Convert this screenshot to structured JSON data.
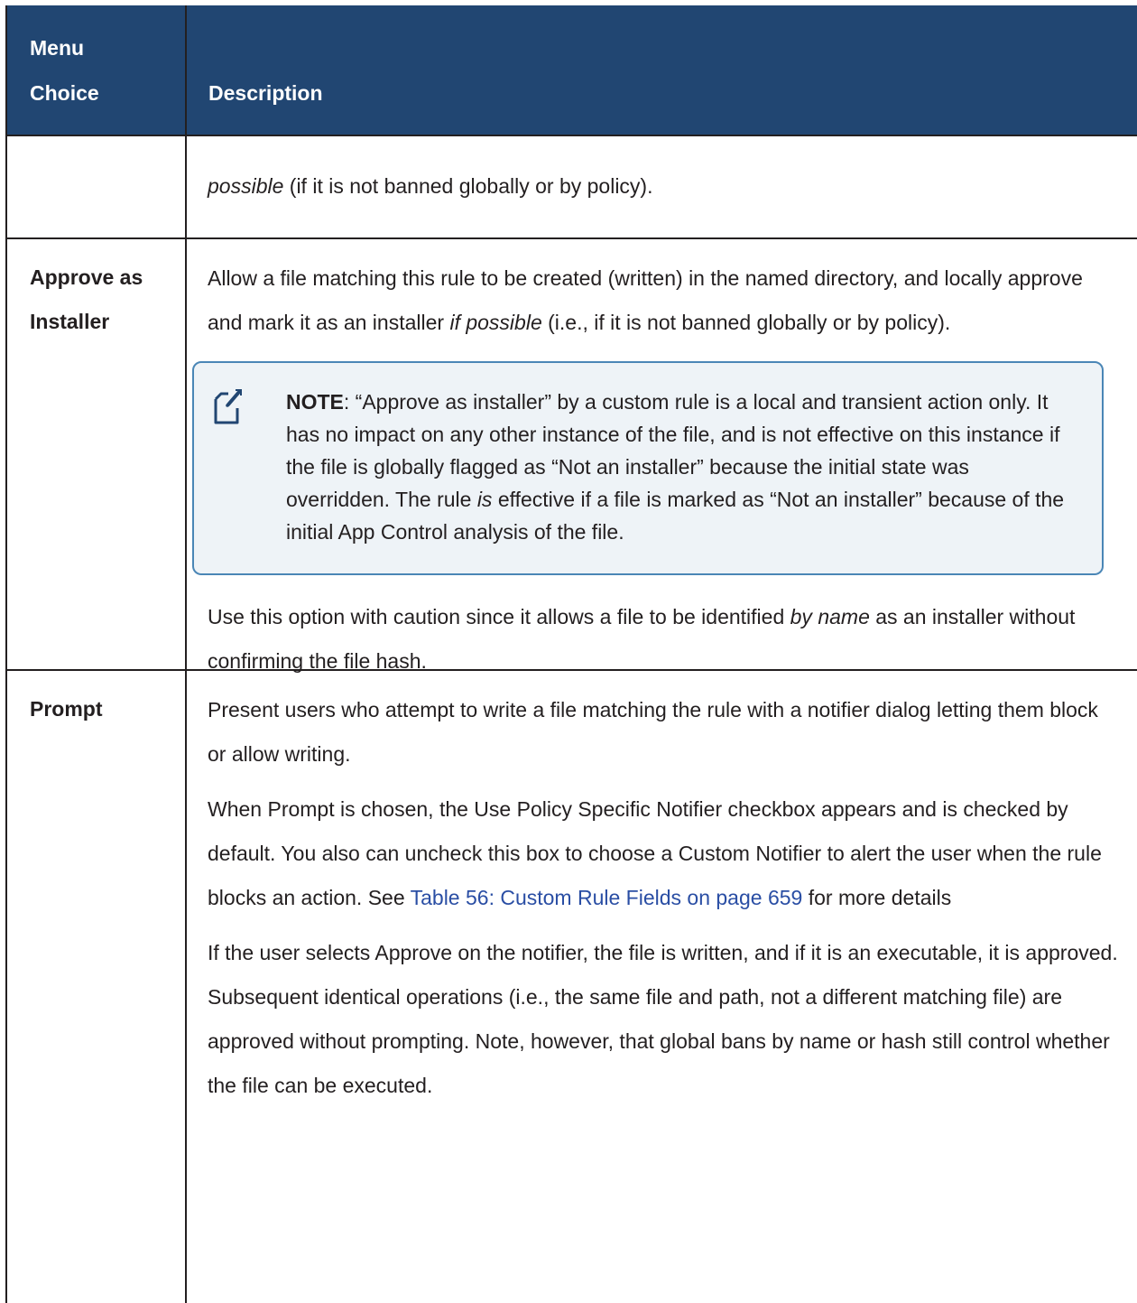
{
  "header": {
    "menu_line1": "Menu",
    "menu_line2": "Choice",
    "description": "Description"
  },
  "row_continued": {
    "italic": "possible",
    "rest": " (if it is not banned globally or by policy)."
  },
  "row_approve_installer": {
    "menu_line1": "Approve as",
    "menu_line2": "Installer",
    "p1_a": "Allow a file matching this rule to be created (written) in the named directory, and locally approve and mark it as an installer ",
    "p1_italic": "if possible",
    "p1_b": " (i.e., if it is not banned globally or by policy).",
    "note_label": "NOTE",
    "note_a": ": “Approve as installer” by a custom rule is a local and transient action only. It has no impact on any other instance of the file, and is not effective on this instance if the file is globally flagged as “Not an installer” because the initial state was overridden. The rule ",
    "note_italic": "is",
    "note_b": " effective if a file is marked as “Not an installer” because of the initial App Control analysis of the file.",
    "p2_a": "Use this option with caution since it allows a file to be identified ",
    "p2_italic": "by name",
    "p2_b": " as an installer without confirming the file hash."
  },
  "row_prompt": {
    "menu": "Prompt",
    "p1": "Present users who attempt to write a file matching the rule with a notifier dialog letting them block or allow writing.",
    "p2_a": "When Prompt is chosen, the Use Policy Specific Notifier checkbox appears and is checked by default. You also can uncheck this box to choose a Custom Notifier to alert the user when the rule blocks an action. See ",
    "p2_link": "Table 56: Custom Rule Fields on page 659",
    "p2_b": " for more details",
    "p3": "If the user selects Approve on the notifier, the file is written, and if it is an executable, it is approved. Subsequent identical operations (i.e., the same file and path, not a different matching file) are approved without prompting. Note, however, that global bans by name or hash still control whether the file can be executed."
  },
  "colors": {
    "header_bg": "#214672",
    "note_border": "#4a86b6",
    "note_bg": "#eef3f7",
    "link": "#2a4ea4"
  }
}
